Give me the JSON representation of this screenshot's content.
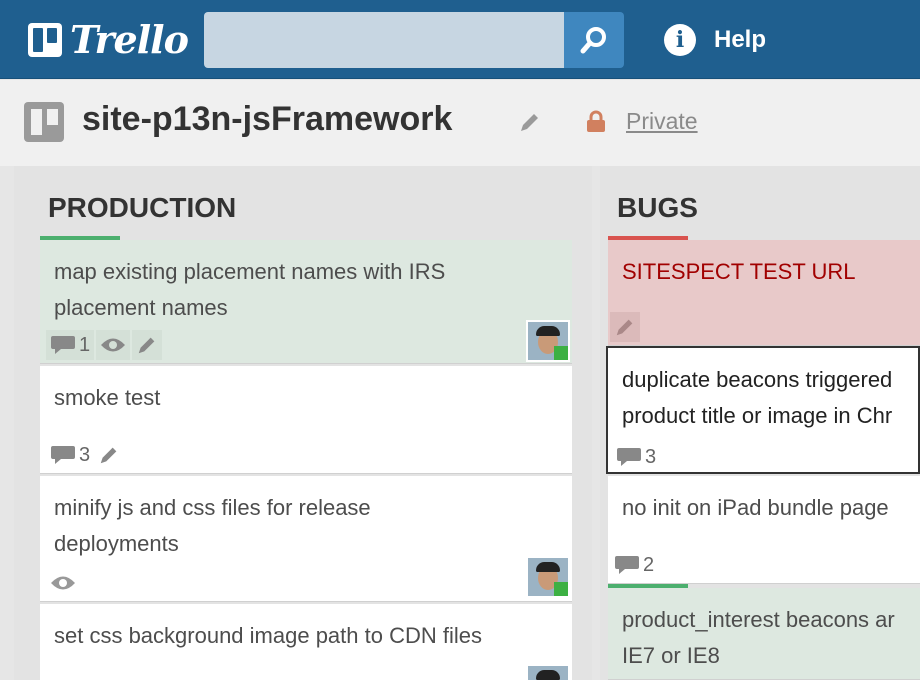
{
  "app": {
    "name": "Trello"
  },
  "header": {
    "search_value": "",
    "search_icon": "search-icon",
    "help_label": "Help",
    "colors": {
      "bar": "#1f5f8f",
      "search_button": "#3f87bf"
    }
  },
  "board": {
    "title": "site-p13n-jsFramework",
    "privacy": "Private",
    "colors": {
      "lock": "#d1805f"
    }
  },
  "lists": [
    {
      "title": "PRODUCTION",
      "accent_color": "#4caf6e",
      "cards": [
        {
          "text1": "map existing placement names with IRS",
          "text2": "placement names",
          "style": "green",
          "comments": "1",
          "watched": true,
          "editable": true,
          "avatar": true
        },
        {
          "text1": "smoke test",
          "text2": "",
          "style": "white",
          "comments": "3",
          "watched": false,
          "editable": true,
          "avatar": false
        },
        {
          "text1": "minify js and css files for release",
          "text2": "deployments",
          "style": "white",
          "comments": "",
          "watched": true,
          "editable": false,
          "avatar": true
        },
        {
          "text1": "set css background image path to CDN files",
          "text2": "",
          "style": "white",
          "comments": "",
          "watched": false,
          "editable": false,
          "avatar": true
        }
      ]
    },
    {
      "title": "BUGS",
      "accent_color": "#d9534f",
      "cards": [
        {
          "text1": "SITESPECT TEST URL",
          "text2": "",
          "style": "red",
          "comments": "",
          "editable": true
        },
        {
          "text1": "duplicate beacons triggered",
          "text2": "product title or image in Chr",
          "style": "selected",
          "comments": "3"
        },
        {
          "text1": "no init on iPad bundle page",
          "text2": "",
          "style": "white",
          "comments": "2"
        },
        {
          "text1": "product_interest beacons ar",
          "text2": "IE7 or IE8",
          "style": "green",
          "comments": ""
        }
      ]
    }
  ]
}
